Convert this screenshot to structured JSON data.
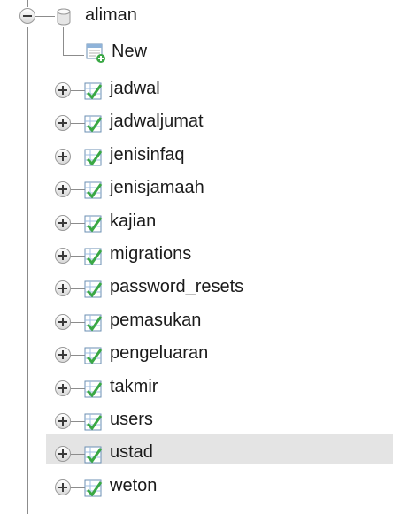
{
  "tree": {
    "database": {
      "name": "aliman",
      "icon": "database-icon",
      "expanded": true
    },
    "new_item": {
      "label": "New",
      "icon": "new-table-icon"
    },
    "tables": [
      {
        "name": "jadwal"
      },
      {
        "name": "jadwaljumat"
      },
      {
        "name": "jenisinfaq"
      },
      {
        "name": "jenisjamaah"
      },
      {
        "name": "kajian"
      },
      {
        "name": "migrations"
      },
      {
        "name": "password_resets"
      },
      {
        "name": "pemasukan"
      },
      {
        "name": "pengeluaran"
      },
      {
        "name": "takmir"
      },
      {
        "name": "users"
      },
      {
        "name": "ustad",
        "selected": true
      },
      {
        "name": "weton"
      }
    ],
    "table_icon": "table-icon",
    "selection_color": "#e4e4e4"
  }
}
